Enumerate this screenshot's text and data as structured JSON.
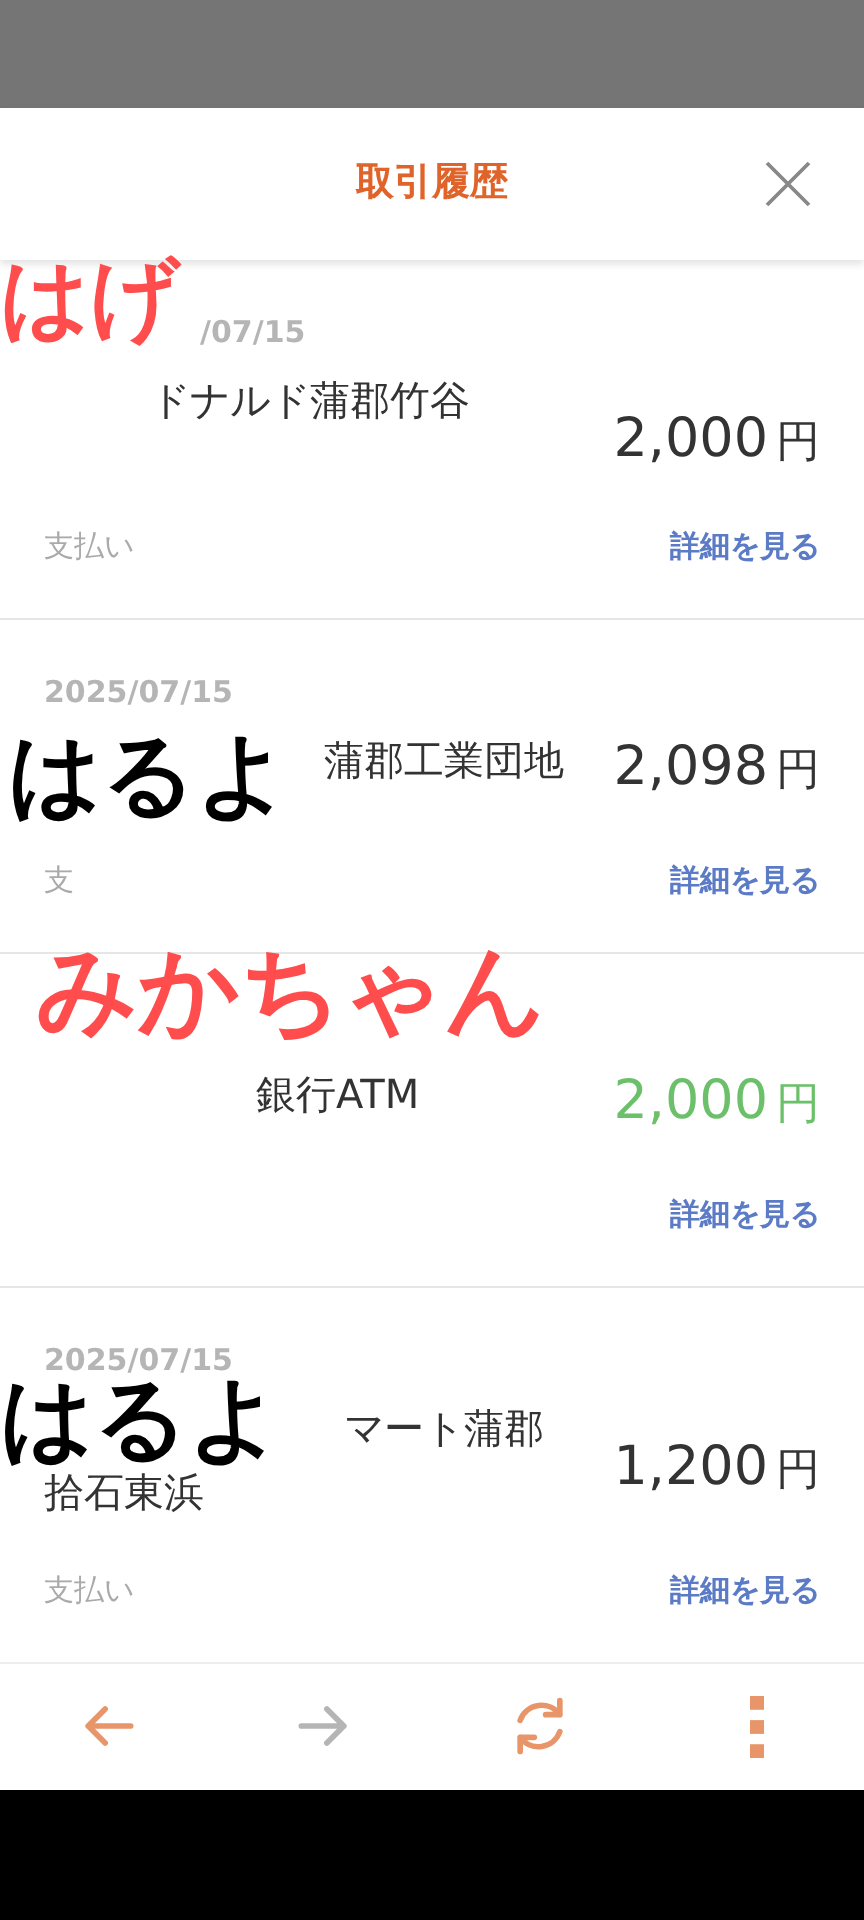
{
  "header": {
    "title": "取引履歴"
  },
  "transactions": [
    {
      "kind": "payment",
      "date": "/07/15",
      "merchant": [
        "ドナルド蒲郡竹谷"
      ],
      "amount": "2,000",
      "currency": "円",
      "type": "支払い",
      "link": "詳細を見る"
    },
    {
      "kind": "payment",
      "date": "2025/07/15",
      "merchant": [
        "蒲郡工業団地"
      ],
      "amount": "2,098",
      "currency": "円",
      "type": "支",
      "link": "詳細を見る"
    },
    {
      "kind": "deposit",
      "merchant": [
        "銀行ATM"
      ],
      "amount": "2,000",
      "currency": "円",
      "link": "詳細を見る"
    },
    {
      "kind": "payment",
      "date": "2025/07/15",
      "merchant": [
        "マート蒲郡",
        "拾石東浜"
      ],
      "amount": "1,200",
      "currency": "円",
      "type": "支払い",
      "link": "詳細を見る"
    }
  ],
  "stickers": [
    {
      "text": "はげ",
      "color": "#ff4d4d"
    },
    {
      "text": "はるよ",
      "color": "#000000"
    },
    {
      "text": "みかちゃん",
      "color": "#ff4d4d"
    },
    {
      "text": "はるよ",
      "color": "#000000"
    }
  ],
  "toolbar": [
    {
      "kind": "back",
      "disabled": false
    },
    {
      "kind": "forward",
      "disabled": true
    },
    {
      "kind": "refresh",
      "disabled": false
    },
    {
      "kind": "more",
      "disabled": false
    }
  ]
}
